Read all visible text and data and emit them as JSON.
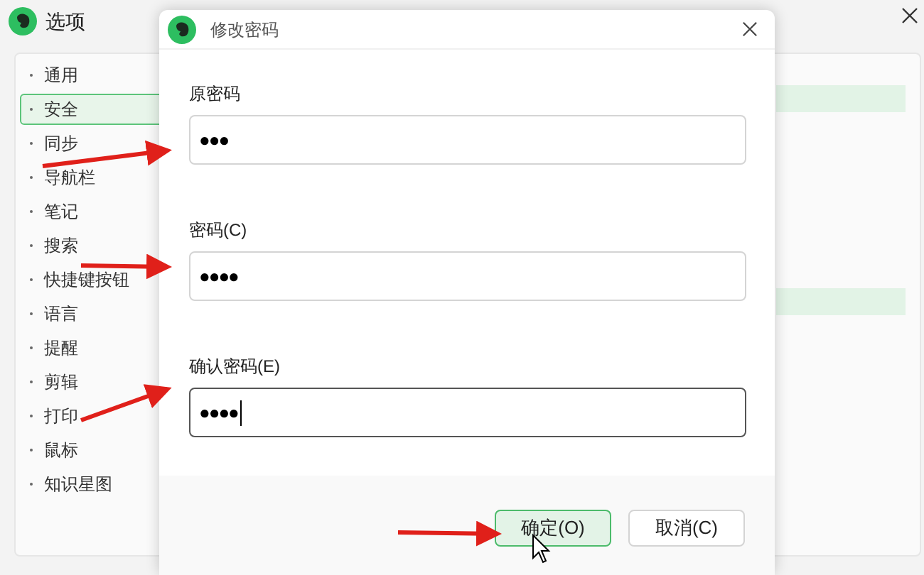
{
  "window": {
    "title": "选项"
  },
  "sidebar": {
    "items": [
      {
        "label": "通用",
        "selected": false
      },
      {
        "label": "安全",
        "selected": true
      },
      {
        "label": "同步",
        "selected": false
      },
      {
        "label": "导航栏",
        "selected": false
      },
      {
        "label": "笔记",
        "selected": false
      },
      {
        "label": "搜索",
        "selected": false
      },
      {
        "label": "快捷键按钮",
        "selected": false
      },
      {
        "label": "语言",
        "selected": false
      },
      {
        "label": "提醒",
        "selected": false
      },
      {
        "label": "剪辑",
        "selected": false
      },
      {
        "label": "打印",
        "selected": false
      },
      {
        "label": "鼠标",
        "selected": false
      },
      {
        "label": "知识星图",
        "selected": false
      }
    ]
  },
  "dialog": {
    "title": "修改密码",
    "fields": [
      {
        "label": "原密码",
        "value": "●●●",
        "focused": false
      },
      {
        "label": "密码(C)",
        "value": "●●●●",
        "focused": false
      },
      {
        "label": "确认密码(E)",
        "value": "●●●●",
        "focused": true
      }
    ],
    "buttons": [
      {
        "label": "确定(O)",
        "primary": true
      },
      {
        "label": "取消(C)",
        "primary": false
      }
    ]
  }
}
